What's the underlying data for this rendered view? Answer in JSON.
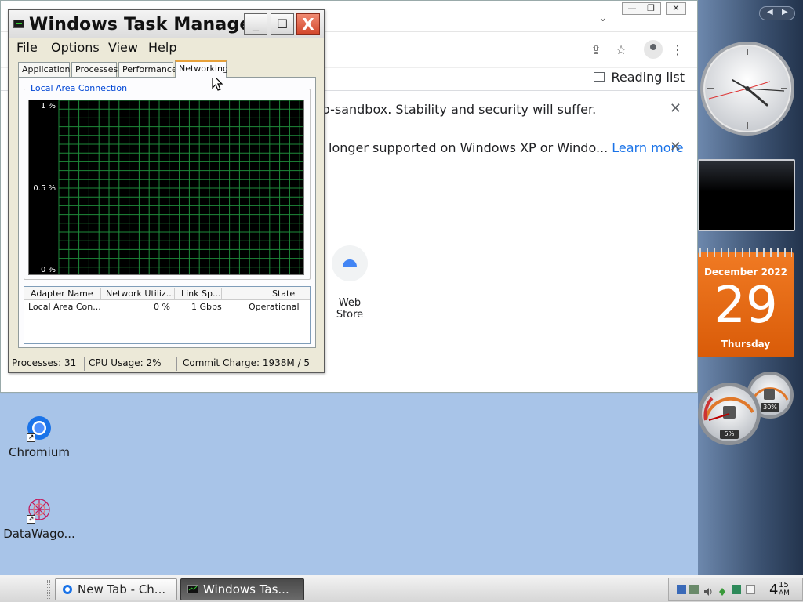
{
  "desktop": {
    "icons": [
      {
        "label": "Chromium"
      },
      {
        "label": "DataWago..."
      }
    ]
  },
  "browser": {
    "window_controls": {
      "minimize": "—",
      "restore": "❐",
      "close": "✕"
    },
    "tab_dropdown": "⌄",
    "toolbar": {
      "share": "⇪",
      "bookmark": "☆",
      "menu": "⋮"
    },
    "reading_list": "Reading list",
    "infobars": [
      {
        "message": "o-sandbox. Stability and security will suffer.",
        "close": "✕"
      },
      {
        "message": "longer supported on Windows XP or Windo...",
        "link": "Learn more",
        "close": "✕"
      }
    ],
    "shortcuts": [
      {
        "label": "Web Store"
      }
    ]
  },
  "task_manager": {
    "title": "Windows Task Manager",
    "title_buttons": {
      "minimize": "_",
      "maximize": "☐",
      "close": "X"
    },
    "menu": [
      {
        "label": "File",
        "key": "F",
        "rest": "ile"
      },
      {
        "label": "Options",
        "key": "O",
        "rest": "ptions"
      },
      {
        "label": "View",
        "key": "V",
        "rest": "iew"
      },
      {
        "label": "Help",
        "key": "H",
        "rest": "elp"
      }
    ],
    "tabs": [
      "Applications",
      "Processes",
      "Performance",
      "Networking"
    ],
    "active_tab": "Networking",
    "group_label": "Local Area Connection",
    "graph": {
      "y_labels": [
        "1 %",
        "0.5 %",
        "0 %"
      ],
      "grid": true,
      "color": "#1e8a3a"
    },
    "adapter_table": {
      "columns": [
        "Adapter Name",
        "Network Utiliz...",
        "Link Sp...",
        "State"
      ],
      "rows": [
        {
          "name": "Local Area Con...",
          "util": "0 %",
          "speed": "1 Gbps",
          "state": "Operational"
        }
      ]
    },
    "status": {
      "processes": "Processes: 31",
      "cpu": "CPU Usage: 2%",
      "commit": "Commit Charge: 1938M / 5"
    }
  },
  "sidebar": {
    "nav": {
      "prev": "◀",
      "next": "▶"
    },
    "calendar": {
      "month_year": "December 2022",
      "day": "29",
      "weekday": "Thursday"
    },
    "meters": {
      "cpu": "5%",
      "memory": "30%"
    }
  },
  "taskbar": {
    "tasks": [
      {
        "label": "New Tab - Ch...",
        "active": false
      },
      {
        "label": "Windows Tas...",
        "active": true
      }
    ],
    "clock": {
      "hour": "4",
      "minute": "15",
      "ampm": "AM"
    }
  }
}
